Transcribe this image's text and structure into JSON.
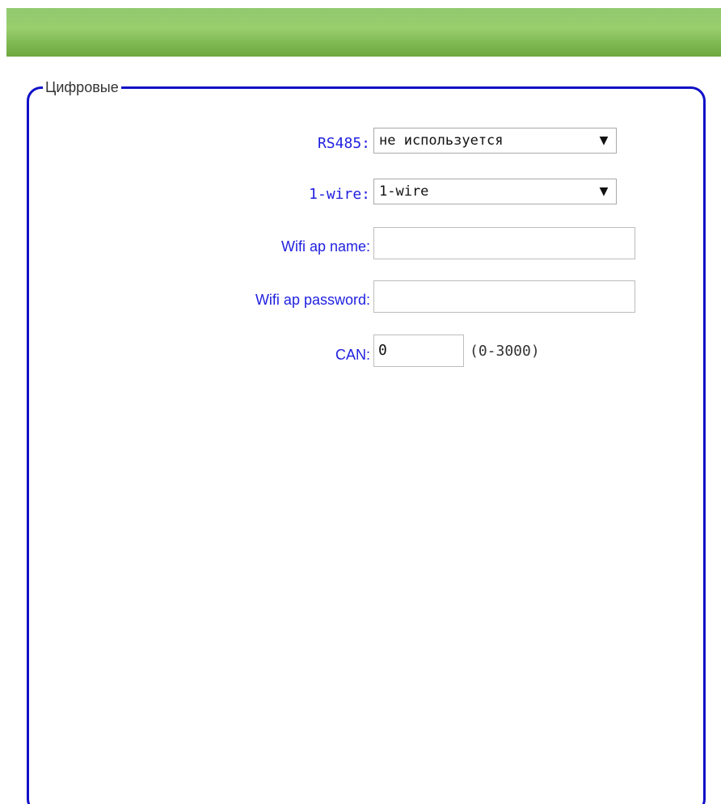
{
  "fieldset": {
    "legend": "Цифровые"
  },
  "form": {
    "rs485": {
      "label": "RS485:",
      "selected": "не используется"
    },
    "one_wire": {
      "label": "1-wire:",
      "selected": "1-wire"
    },
    "wifi_ap_name": {
      "label": "Wifi ap name:",
      "value": ""
    },
    "wifi_ap_password": {
      "label": "Wifi ap password:",
      "value": ""
    },
    "can": {
      "label": "CAN:",
      "value": "0",
      "hint": "(0-3000)"
    }
  },
  "icons": {
    "dropdown": "chevron-down-icon",
    "dropdown_glyph": "▼"
  },
  "colors": {
    "header_green": "#7eba52",
    "label_blue": "#1f1fe0",
    "fieldset_border": "#1010c8"
  }
}
